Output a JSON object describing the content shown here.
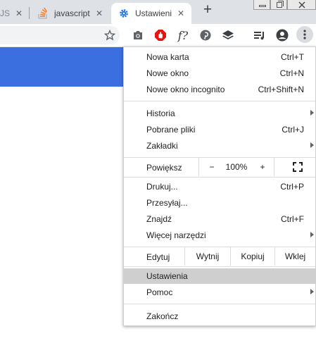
{
  "tabs": [
    {
      "title": "rJS",
      "active": false
    },
    {
      "title": "javascript",
      "active": false
    },
    {
      "title": "Ustawienia",
      "active": true
    }
  ],
  "tab_close_glyph": "✕",
  "new_tab_glyph": "+",
  "toolbar": {
    "icons": [
      "star-icon",
      "camera-icon",
      "adblock-icon",
      "function-icon",
      "pinterest-icon",
      "layers-icon",
      "playlist-icon",
      "profile-icon",
      "more-menu-icon"
    ],
    "function_label": "f?"
  },
  "menu": {
    "group1": [
      {
        "label": "Nowa karta",
        "shortcut": "Ctrl+T"
      },
      {
        "label": "Nowe okno",
        "shortcut": "Ctrl+N"
      },
      {
        "label": "Nowe okno incognito",
        "shortcut": "Ctrl+Shift+N"
      }
    ],
    "group2": [
      {
        "label": "Historia",
        "submenu": true
      },
      {
        "label": "Pobrane pliki",
        "shortcut": "Ctrl+J"
      },
      {
        "label": "Zakładki",
        "submenu": true
      }
    ],
    "zoom": {
      "label": "Powiększ",
      "minus": "−",
      "value": "100%",
      "plus": "+"
    },
    "group3": [
      {
        "label": "Drukuj...",
        "shortcut": "Ctrl+P"
      },
      {
        "label": "Przesyłaj..."
      },
      {
        "label": "Znajdź",
        "shortcut": "Ctrl+F"
      },
      {
        "label": "Więcej narzędzi",
        "submenu": true
      }
    ],
    "edit": {
      "label": "Edytuj",
      "cut": "Wytnij",
      "copy": "Kopiuj",
      "paste": "Wklej"
    },
    "group4": [
      {
        "label": "Ustawienia",
        "highlighted": true
      },
      {
        "label": "Pomoc",
        "submenu": true
      }
    ],
    "exit": {
      "label": "Zakończ"
    }
  },
  "colors": {
    "accent": "#3b6fe0",
    "settings_icon": "#1a73e8",
    "adblock": "#e8110f",
    "highlight": "#cfcfcf"
  }
}
